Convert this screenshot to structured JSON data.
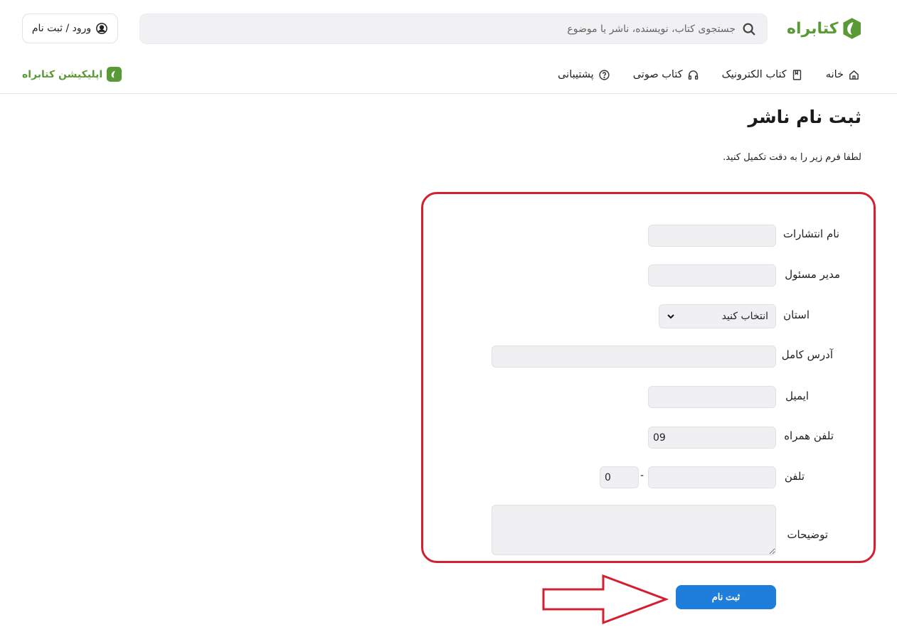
{
  "header": {
    "login_label": "ورود / ثبت نام",
    "search_placeholder": "جستجوی کتاب، نویسنده، ناشر یا موضوع",
    "logo_text": "کتابراه"
  },
  "nav": {
    "items": [
      {
        "label": "خانه",
        "icon": "home-icon"
      },
      {
        "label": "کتاب الکترونیک",
        "icon": "book-icon"
      },
      {
        "label": "کتاب صوتی",
        "icon": "headphones-icon"
      },
      {
        "label": "پشتیبانی",
        "icon": "help-circle-icon"
      }
    ],
    "app_link": "اپلیکیشن کتابراه"
  },
  "page": {
    "title": "ثبت نام ناشر",
    "subtitle": "لطفا فرم زیر را به دقت تکمیل کنید."
  },
  "form": {
    "publisher_name_label": "نام انتشارات",
    "manager_label": "مدیر مسئول",
    "province_label": "استان",
    "province_value": "انتخاب کنید",
    "address_label": "آدرس کامل",
    "email_label": "ایمیل",
    "mobile_label": "تلفن همراه",
    "mobile_value": "09",
    "phone_label": "تلفن",
    "phone_area_value": "0",
    "phone_separator": "-",
    "description_label": "توضیحات",
    "submit_label": "ثبت نام"
  },
  "colors": {
    "brand_green": "#5a9a36",
    "submit_blue": "#1f7ddc",
    "highlight_red": "#d32030"
  }
}
